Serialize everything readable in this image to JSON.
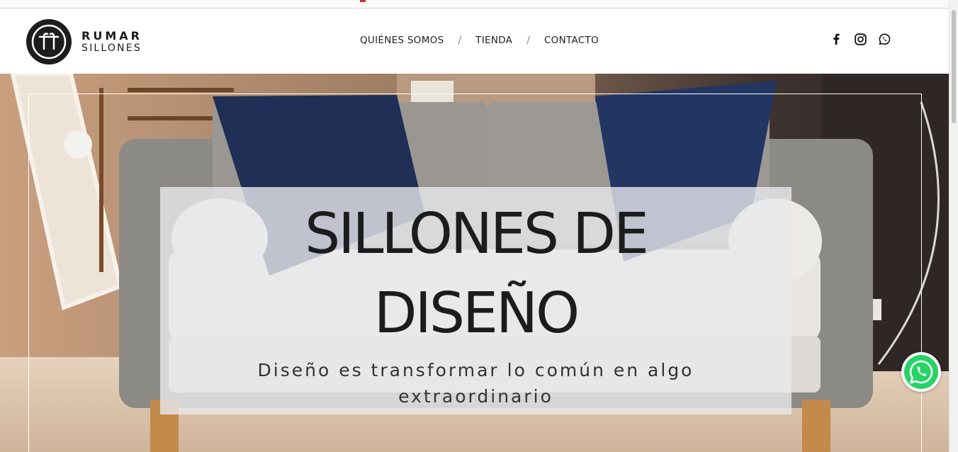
{
  "brand": {
    "name": "RUMAR",
    "tagline": "SILLONES"
  },
  "nav": {
    "items": [
      "QUIÉNES SOMOS",
      "TIENDA",
      "CONTACTO"
    ],
    "separator": "/"
  },
  "social": [
    "facebook-icon",
    "instagram-icon",
    "whatsapp-icon"
  ],
  "hero": {
    "title_line1": "SILLONES DE",
    "title_line2": "DISEÑO",
    "subtitle": "Diseño es transformar lo común en algo extraordinario"
  },
  "floating": {
    "icon": "whatsapp-icon",
    "color": "#25d366"
  },
  "colors": {
    "overlay": "#e8e8ec",
    "cushion": "#1f2f55",
    "sofa": "#8c8a86"
  }
}
